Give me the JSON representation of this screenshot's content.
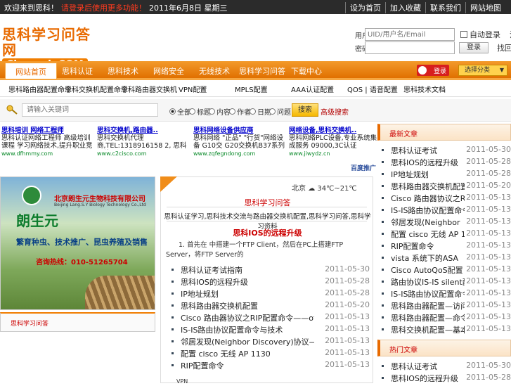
{
  "topbar": {
    "welcome": "欢迎来到思科！",
    "notice": "请登录后使用更多功能！",
    "date": "2011年6月8日 星期三",
    "links": [
      "设为首页",
      "加入收藏",
      "联系我们",
      "网站地图"
    ]
  },
  "logo": {
    "cn": "思科学习问答网",
    "en": "Ciscoask.COM"
  },
  "login": {
    "user_label": "用户",
    "user_placeholder": "UID/用户名/Email",
    "pass_label": "密码",
    "remember": "自动登录",
    "register": "注册",
    "submit": "登录",
    "forgot": "找回密码"
  },
  "nav": {
    "items": [
      "网站首页",
      "思科认证",
      "思科技术",
      "网络安全",
      "无线技术",
      "思科学习问答",
      "下载中心"
    ],
    "login_label": "登录",
    "select_label": "选择分类"
  },
  "subnav": [
    "思科路由器配置命令",
    "思科交换机配置命令",
    "思科路由器交换机",
    "VPN配置",
    "MPLS配置",
    "AAA认证配置",
    "QOS | 语音配置",
    "思科技术文档"
  ],
  "search": {
    "placeholder": "请输入关键词",
    "options": [
      "全部",
      "标题",
      "内容",
      "作者",
      "日期",
      "问题"
    ],
    "selected": "全部",
    "go": "搜索",
    "advanced": "高级搜索"
  },
  "ads": [
    {
      "title": "思科培训 网络工程师",
      "body": "思科认证网络工程师 高级培训课程 学习网络技术,提升职业竞争05",
      "url": "www.dfhmmy.com"
    },
    {
      "title": "思科交换机,路由器..",
      "body": "思科交换机代理商,TEL:1318916158 2, 思科网络,OEM供货",
      "url": "www.c2cisco.com"
    },
    {
      "title": "思科网络设备供应商",
      "body": "思科网络 \"正品\" \"行货\"网络设备 G10交 G20交换机B37系列",
      "url": "www.zqfegndong.com"
    },
    {
      "title": "网络设备,思科交换机..",
      "body": "思科网络PLC设备,专业系统集成服务 09000,3C认证",
      "url": "www.jiwydz.cn"
    }
  ],
  "ads_source": "百度推广",
  "banner": {
    "company": "北京朗生元生物科技有限公司",
    "company_en": "Beijing Lang.S.Y Biology Technology Co.,Ltd",
    "brand": "朗生元",
    "slogan": "繁育种虫、技术推广、昆虫养殖及销售",
    "hotline": "咨询热线：010-51265704"
  },
  "left_tab": "思科学习问答",
  "center": {
    "weather_city": "北京",
    "weather_icon": "cloud-icon",
    "weather_temp": "34℃~21℃",
    "news_title": "思科学习问答",
    "news_line": "思科认证学习,思科技术交流与路由器交换机配置,思科学习问答,思科学习资料",
    "headline": "思科IOS的远程升级",
    "summary": "1. 首先在 中搭建一个FTP Client，然后在PC上搭建FTP Server，将FTP Server的",
    "items": [
      {
        "title": "思科认证考试指南",
        "date": "2011-05-30"
      },
      {
        "title": "思科IOS的远程升级",
        "date": "2011-05-28"
      },
      {
        "title": "IP地址规划",
        "date": "2011-05-28"
      },
      {
        "title": "思科路由器交换机配置",
        "date": "2011-05-20"
      },
      {
        "title": "Cisco 路由器协议之RIP配置命令——offset-",
        "date": "2011-05-13"
      },
      {
        "title": "IS-IS路由协议配置命令与技术",
        "date": "2011-05-13"
      },
      {
        "title": "邻居发现(Neighbor Discovery)协议——NDP",
        "date": "2011-05-13"
      },
      {
        "title": "配置 cisco 无线 AP 1130",
        "date": "2011-05-13"
      },
      {
        "title": "RIP配置命令",
        "date": "2011-05-13"
      }
    ],
    "vpn_label": "VPN"
  },
  "sidebar": [
    {
      "title": "最新文章",
      "items": [
        {
          "title": "思科认证考试",
          "date": "2011-05-30"
        },
        {
          "title": "思科IOS的远程升级",
          "date": "2011-05-28"
        },
        {
          "title": "IP地址规划",
          "date": "2011-05-28"
        },
        {
          "title": "思科路由器交换机配置",
          "date": "2011-05-20"
        },
        {
          "title": "Cisco 路由器协议之RIP配置命令",
          "date": "2011-05-13"
        },
        {
          "title": "IS-IS路由协议配置命令与技术",
          "date": "2011-05-13"
        },
        {
          "title": "邻居发现(Neighbor",
          "date": "2011-05-13"
        },
        {
          "title": "配置 cisco 无线 AP 1130",
          "date": "2011-05-13"
        },
        {
          "title": "RIP配置命令",
          "date": "2011-05-13"
        },
        {
          "title": "vista 系统下的ASA",
          "date": "2011-05-13"
        },
        {
          "title": "Cisco AutoQoS配置",
          "date": "2011-05-13"
        },
        {
          "title": "路由协议IS-IS silent配置命令",
          "date": "2011-05-13"
        },
        {
          "title": "IS-IS路由协议配置命令",
          "date": "2011-05-13"
        },
        {
          "title": "思科路由器配置—访问控制",
          "date": "2011-05-13"
        },
        {
          "title": "思科路由器配置—命令",
          "date": "2011-05-13"
        },
        {
          "title": "思科交换机配置—基本配置",
          "date": "2011-05-13"
        }
      ]
    },
    {
      "title": "热门文章",
      "items": [
        {
          "title": "思科认证考试",
          "date": "2011-05-30"
        },
        {
          "title": "思科IOS的远程升级",
          "date": "2011-05-28"
        }
      ]
    }
  ]
}
